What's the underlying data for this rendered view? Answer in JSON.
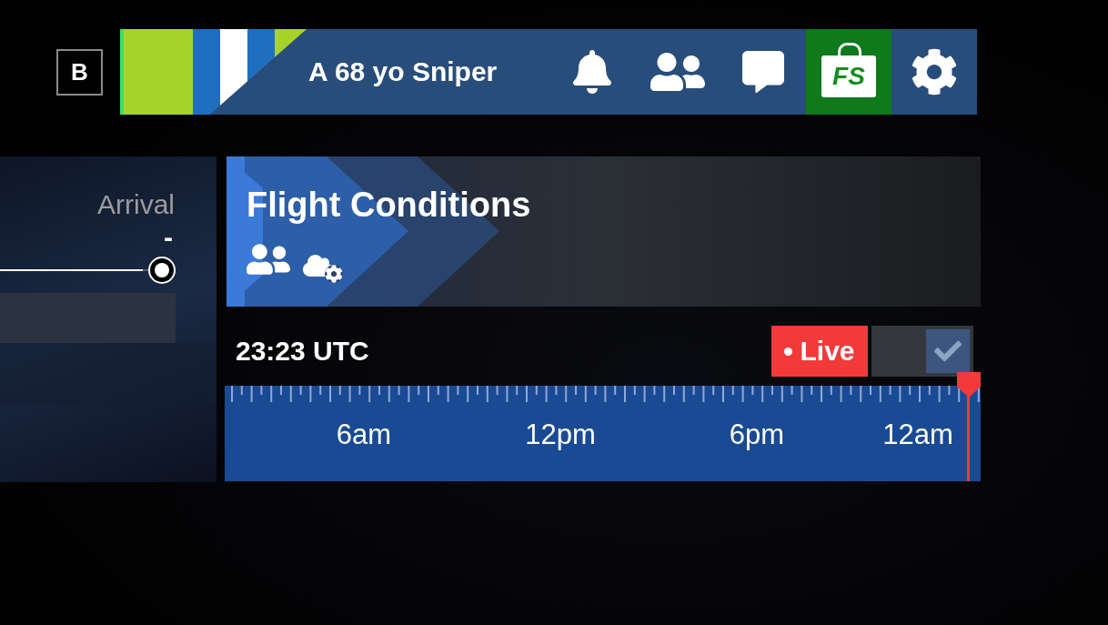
{
  "profile_bar": {
    "badge": "B",
    "username": "A 68 yo Sniper",
    "store_label": "FS"
  },
  "route_panel": {
    "label": "Arrival",
    "value": "-",
    "slider": {
      "level": 1
    }
  },
  "flight_conditions": {
    "title": "Flight Conditions",
    "time": "23:23 UTC",
    "live": {
      "label": "Live",
      "checked": true
    },
    "timeline": {
      "labels": [
        "6am",
        "12pm",
        "6pm",
        "12am"
      ],
      "level": 1
    }
  }
}
